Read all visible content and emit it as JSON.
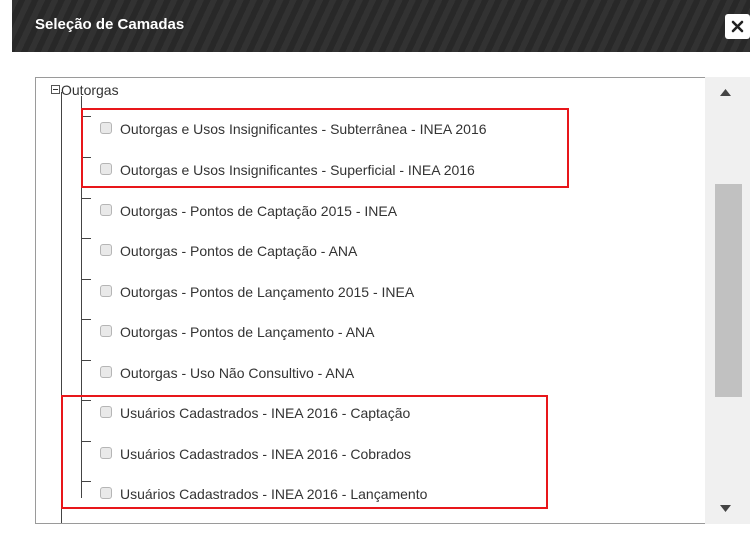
{
  "dialog": {
    "title": "Seleção de Camadas",
    "close_icon": "close-icon"
  },
  "tree": {
    "root_label": "Outorgas",
    "items": [
      {
        "label": "Outorgas e Usos Insignificantes - Subterrânea - INEA 2016",
        "checked": false
      },
      {
        "label": "Outorgas e Usos Insignificantes - Superficial - INEA 2016",
        "checked": false
      },
      {
        "label": "Outorgas - Pontos de Captação 2015 - INEA",
        "checked": false
      },
      {
        "label": "Outorgas - Pontos de Captação - ANA",
        "checked": false
      },
      {
        "label": "Outorgas - Pontos de Lançamento 2015 - INEA",
        "checked": false
      },
      {
        "label": "Outorgas - Pontos de Lançamento - ANA",
        "checked": false
      },
      {
        "label": "Outorgas - Uso Não Consultivo - ANA",
        "checked": false
      },
      {
        "label": "Usuários Cadastrados - INEA 2016 - Captação",
        "checked": false
      },
      {
        "label": "Usuários Cadastrados - INEA 2016 - Cobrados",
        "checked": false
      },
      {
        "label": "Usuários Cadastrados - INEA 2016 - Lançamento",
        "checked": false
      }
    ]
  },
  "colors": {
    "titlebar": "#2b2b2b",
    "highlight": "#e8161a"
  }
}
